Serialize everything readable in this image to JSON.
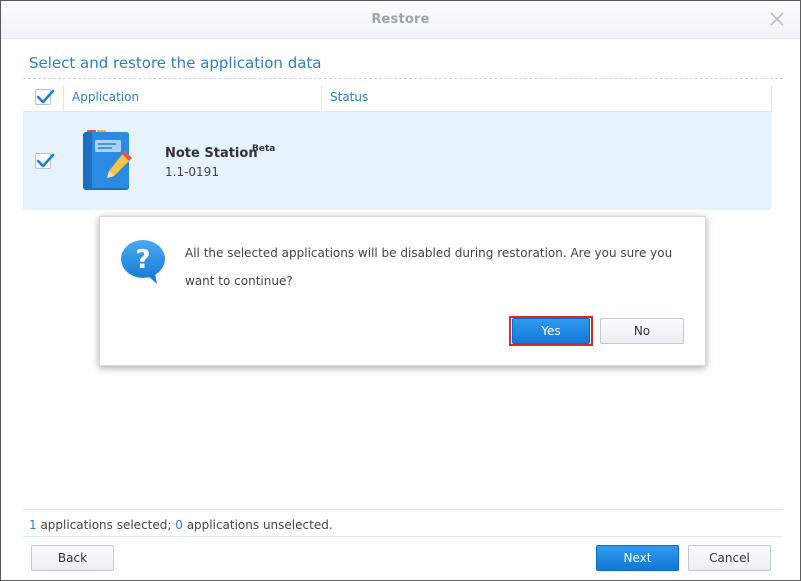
{
  "window": {
    "title": "Restore"
  },
  "heading": "Select and restore the application data",
  "grid": {
    "columns": [
      "Application",
      "Status"
    ],
    "header_checked": true
  },
  "row": {
    "checked": true,
    "app_name": "Note Station",
    "badge": "Beta",
    "version": "1.1-0191",
    "icon": "note-station-icon"
  },
  "dialog": {
    "icon": "question-icon",
    "message_line1": "All the selected applications will be disabled during restoration. Are you sure you",
    "message_line2": "want to continue?",
    "yes_label": "Yes",
    "no_label": "No"
  },
  "summary": {
    "selected_count": "1",
    "selected_text": " applications selected; ",
    "unselected_count": "0",
    "unselected_text": " applications unselected."
  },
  "footer": {
    "back_label": "Back",
    "next_label": "Next",
    "cancel_label": "Cancel"
  },
  "colors": {
    "accent": "#2c80c8",
    "primary_button": "#1a86e3",
    "row_highlight": "#e6f3fd",
    "focus_outline": "#d42a2a"
  }
}
